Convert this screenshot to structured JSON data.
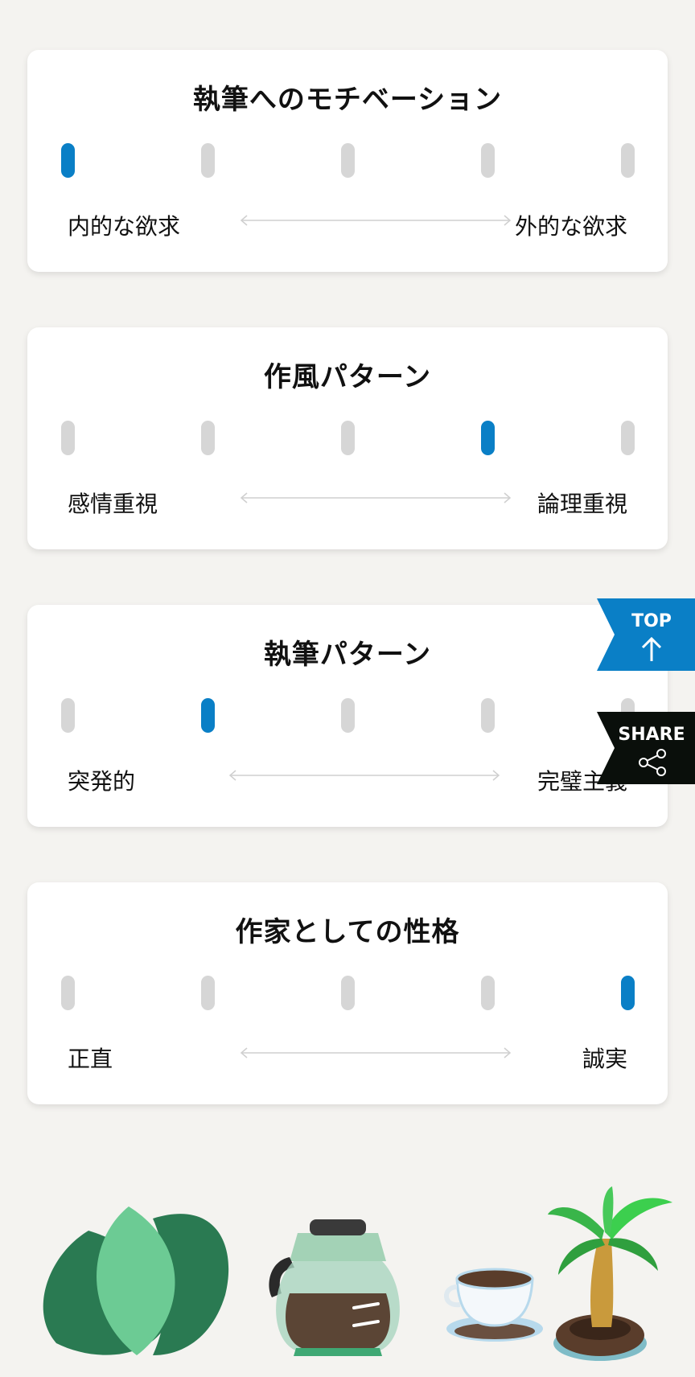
{
  "cards": [
    {
      "title": "執筆へのモチベーション",
      "left_label": "内的な欲求",
      "right_label": "外的な欲求",
      "selected": 1,
      "steps": 5
    },
    {
      "title": "作風パターン",
      "left_label": "感情重視",
      "right_label": "論理重視",
      "selected": 4,
      "steps": 5
    },
    {
      "title": "執筆パターン",
      "left_label": "突発的",
      "right_label": "完璧主義",
      "selected": 2,
      "steps": 5
    },
    {
      "title": "作家としての性格",
      "left_label": "正直",
      "right_label": "誠実",
      "selected": 5,
      "steps": 5
    }
  ],
  "floating": {
    "top_label": "TOP",
    "share_label": "SHARE"
  },
  "colors": {
    "accent": "#0a7fc6",
    "inactive": "#d6d6d6",
    "share_bg": "#0a0f0b",
    "background": "#f4f3f0"
  },
  "icons": [
    "arrow-up-icon",
    "share-icon",
    "double-arrow-icon"
  ]
}
